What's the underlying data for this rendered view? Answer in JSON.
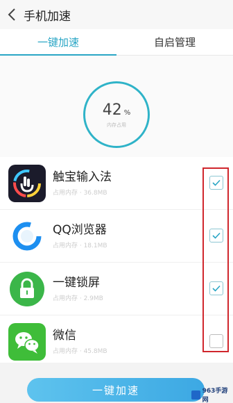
{
  "header": {
    "title": "手机加速",
    "back_icon": "back-arrow-icon"
  },
  "tabs": [
    {
      "label": "一键加速",
      "active": true
    },
    {
      "label": "自启管理",
      "active": false
    }
  ],
  "memory": {
    "value": "42",
    "unit": "%",
    "label": "内存占用"
  },
  "apps": [
    {
      "name": "触宝输入法",
      "detail": "占用内存 · 36.8MB",
      "checked": true,
      "icon": "touchpal-icon"
    },
    {
      "name": "QQ浏览器",
      "detail": "占用内存 · 18.1MB",
      "checked": true,
      "icon": "qq-browser-icon"
    },
    {
      "name": "一键锁屏",
      "detail": "占用内存 · 2.9MB",
      "checked": true,
      "icon": "lock-icon"
    },
    {
      "name": "微信",
      "detail": "占用内存 · 45.8MB",
      "checked": false,
      "icon": "wechat-icon"
    }
  ],
  "button": {
    "label": "一键加速"
  },
  "watermark": {
    "text": "963手游网"
  },
  "colors": {
    "accent": "#2aa6c5",
    "highlight": "#d0262c",
    "button": "#4cb6e8"
  }
}
